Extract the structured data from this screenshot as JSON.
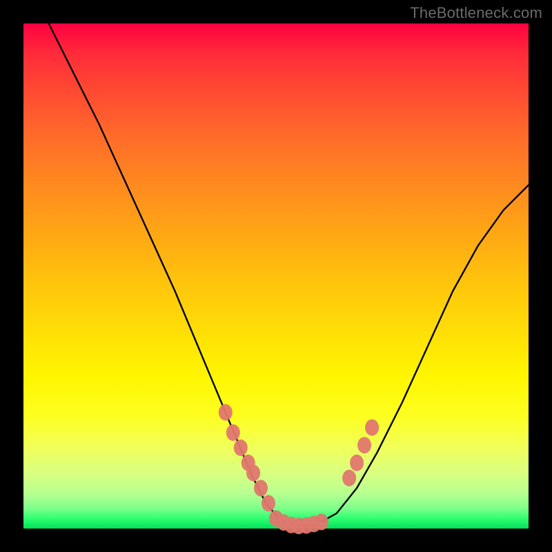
{
  "watermark": "TheBottleneck.com",
  "chart_data": {
    "type": "line",
    "title": "",
    "xlabel": "",
    "ylabel": "",
    "xlim": [
      0,
      100
    ],
    "ylim": [
      0,
      100
    ],
    "annotations": [],
    "series": [
      {
        "name": "curve",
        "style": "black-line",
        "x": [
          0,
          5,
          10,
          15,
          20,
          25,
          30,
          35,
          40,
          45,
          48,
          51,
          54,
          58,
          62,
          66,
          70,
          75,
          80,
          85,
          90,
          95,
          100
        ],
        "values": [
          110,
          100,
          90,
          80,
          69,
          58,
          47,
          35,
          23,
          11,
          5,
          1.5,
          0.5,
          0.8,
          3,
          8,
          15,
          25,
          36,
          47,
          56,
          63,
          68
        ]
      },
      {
        "name": "highlight-points-left",
        "style": "salmon-dot",
        "x": [
          40,
          41.5,
          43,
          44.5,
          45.5,
          47,
          48.5
        ],
        "values": [
          23,
          19,
          16,
          13,
          11,
          8,
          5
        ]
      },
      {
        "name": "highlight-points-bottom",
        "style": "salmon-dot",
        "x": [
          50,
          51.5,
          53,
          54.5,
          56,
          57.5,
          59
        ],
        "values": [
          2,
          1.2,
          0.7,
          0.5,
          0.6,
          0.9,
          1.3
        ]
      },
      {
        "name": "highlight-points-right",
        "style": "salmon-dot",
        "x": [
          64.5,
          66,
          67.5,
          69
        ],
        "values": [
          10,
          13,
          16.5,
          20
        ]
      }
    ],
    "gradient_stops": [
      {
        "pos": 0,
        "color": "#ff0040"
      },
      {
        "pos": 50,
        "color": "#ffc60c"
      },
      {
        "pos": 78,
        "color": "#fdff22"
      },
      {
        "pos": 100,
        "color": "#00e05a"
      }
    ]
  }
}
